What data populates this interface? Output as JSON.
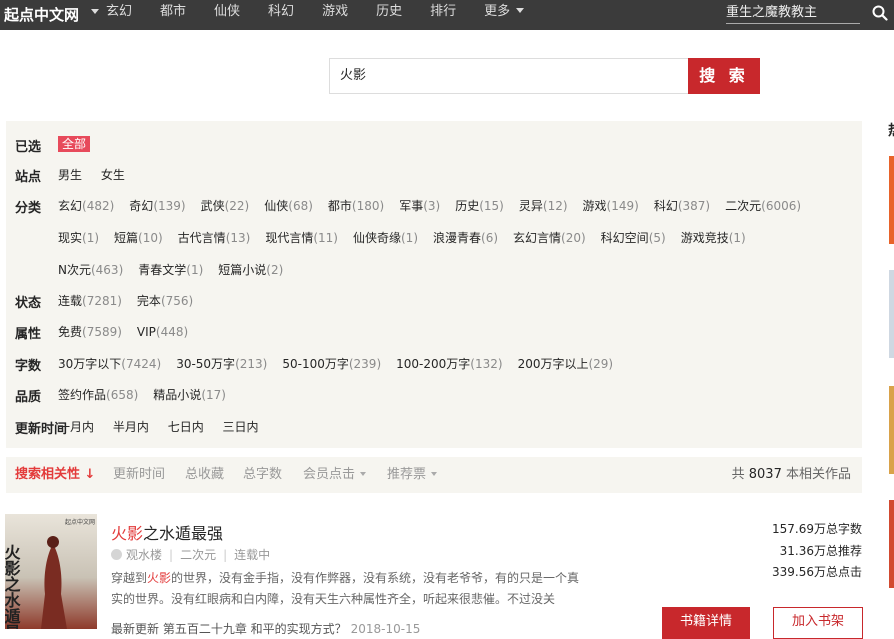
{
  "topbar": {
    "logo": "起点中文网",
    "nav": [
      "玄幻",
      "都市",
      "仙侠",
      "科幻",
      "游戏",
      "历史",
      "排行"
    ],
    "more": "更多",
    "search_value": "重生之魔教教主"
  },
  "search": {
    "value": "火影",
    "button": "搜 索"
  },
  "edge": {
    "title": "热"
  },
  "filters": {
    "selected_label": "已选",
    "selected_tag": "全部",
    "site_label": "站点",
    "sites": [
      "男生",
      "女生"
    ],
    "category_label": "分类",
    "categories_row1": [
      {
        "name": "玄幻",
        "count": "(482)"
      },
      {
        "name": "奇幻",
        "count": "(139)"
      },
      {
        "name": "武侠",
        "count": "(22)"
      },
      {
        "name": "仙侠",
        "count": "(68)"
      },
      {
        "name": "都市",
        "count": "(180)"
      },
      {
        "name": "军事",
        "count": "(3)"
      },
      {
        "name": "历史",
        "count": "(15)"
      },
      {
        "name": "灵异",
        "count": "(12)"
      },
      {
        "name": "游戏",
        "count": "(149)"
      },
      {
        "name": "科幻",
        "count": "(387)"
      },
      {
        "name": "二次元",
        "count": "(6006)"
      }
    ],
    "categories_row2": [
      {
        "name": "现实",
        "count": "(1)"
      },
      {
        "name": "短篇",
        "count": "(10)"
      },
      {
        "name": "古代言情",
        "count": "(13)"
      },
      {
        "name": "现代言情",
        "count": "(11)"
      },
      {
        "name": "仙侠奇缘",
        "count": "(1)"
      },
      {
        "name": "浪漫青春",
        "count": "(6)"
      },
      {
        "name": "玄幻言情",
        "count": "(20)"
      },
      {
        "name": "科幻空间",
        "count": "(5)"
      },
      {
        "name": "游戏竞技",
        "count": "(1)"
      }
    ],
    "categories_row3": [
      {
        "name": "N次元",
        "count": "(463)"
      },
      {
        "name": "青春文学",
        "count": "(1)"
      },
      {
        "name": "短篇小说",
        "count": "(2)"
      }
    ],
    "status_label": "状态",
    "status": [
      {
        "name": "连载",
        "count": "(7281)"
      },
      {
        "name": "完本",
        "count": "(756)"
      }
    ],
    "attr_label": "属性",
    "attrs": [
      {
        "name": "免费",
        "count": "(7589)"
      },
      {
        "name": "VIP",
        "count": "(448)"
      }
    ],
    "words_label": "字数",
    "words": [
      {
        "name": "30万字以下",
        "count": "(7424)"
      },
      {
        "name": "30-50万字",
        "count": "(213)"
      },
      {
        "name": "50-100万字",
        "count": "(239)"
      },
      {
        "name": "100-200万字",
        "count": "(132)"
      },
      {
        "name": "200万字以上",
        "count": "(29)"
      }
    ],
    "quality_label": "品质",
    "quality": [
      {
        "name": "签约作品",
        "count": "(658)"
      },
      {
        "name": "精品小说",
        "count": "(17)"
      }
    ],
    "update_label": "更新时间",
    "updates": [
      "一月内",
      "半月内",
      "七日内",
      "三日内"
    ]
  },
  "sort": {
    "relevance": "搜索相关性",
    "arrow": "↓",
    "update_time": "更新时间",
    "total_fav": "总收藏",
    "total_words": "总字数",
    "member_click": "会员点击",
    "rec_votes": "推荐票",
    "total_prefix": "共",
    "total_count": "8037",
    "total_suffix": "本相关作品"
  },
  "book": {
    "title_hl": "火影",
    "title_rest": "之水遁最强",
    "author": "观水楼",
    "category": "二次元",
    "status": "连载中",
    "intro_1": "穿越到",
    "intro_hl": "火影",
    "intro_2": "的世界，没有金手指，没有作弊器，没有系统，没有老爷爷，有的只是一个真实的世界。没有红眼病和白内障，没有天生六种属性齐全，听起来很悲催。不过没关",
    "latest": "最新更新  第五百二十九章 和平的实现方式？",
    "latest_date": "2018-10-15",
    "stat_words": "157.69万总字数",
    "stat_rec": "31.36万总推荐",
    "stat_clicks": "339.56万总点击",
    "detail_btn": "书籍详情",
    "shelf_btn": "加入书架"
  },
  "cover": {
    "publisher": "起点中文网",
    "title_glyphs": "火影之水遁最强"
  },
  "colors": {
    "accent": "#c8282c",
    "highlight": "#e33b3b",
    "topbar": "#3b3b3b",
    "panel": "#f6f5f0"
  }
}
